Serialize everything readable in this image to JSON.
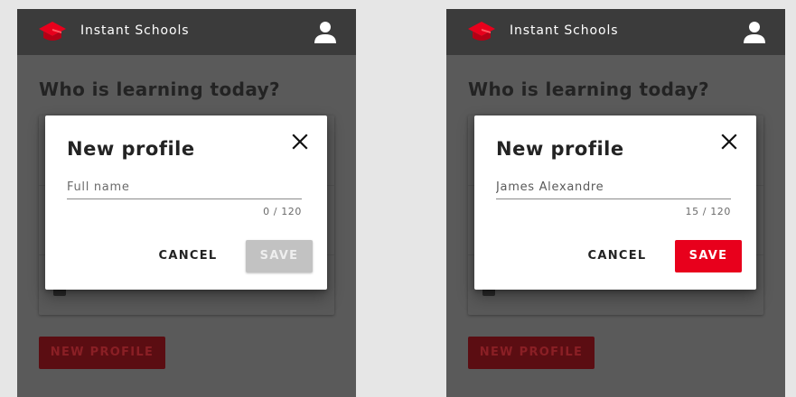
{
  "app": {
    "title": "Instant Schools",
    "colors": {
      "appbar": "#3b3b3b",
      "accent": "#e8001c",
      "overlay_bg": "#5a5a5a"
    },
    "icons": {
      "logo": "graduation-cap-icon",
      "account": "person-icon",
      "close": "close-icon"
    }
  },
  "screens": [
    {
      "page_heading": "Who is learning today?",
      "new_profile_button": "NEW PROFILE",
      "dialog": {
        "title": "New profile",
        "name_field": {
          "value": "",
          "placeholder": "Full name"
        },
        "counter": "0 / 120",
        "cancel_label": "CANCEL",
        "save_label": "SAVE",
        "save_enabled": false
      }
    },
    {
      "page_heading": "Who is learning today?",
      "new_profile_button": "NEW PROFILE",
      "dialog": {
        "title": "New profile",
        "name_field": {
          "value": "James Alexandre",
          "placeholder": "Full name"
        },
        "counter": "15 / 120",
        "cancel_label": "CANCEL",
        "save_label": "SAVE",
        "save_enabled": true
      }
    }
  ]
}
